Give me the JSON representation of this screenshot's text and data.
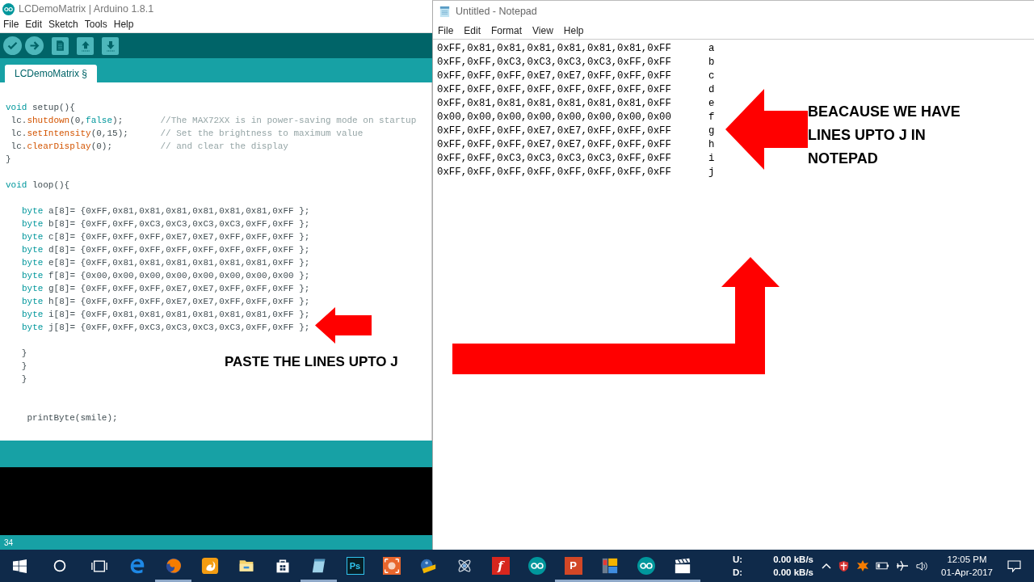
{
  "arduino": {
    "title": "LCDemoMatrix | Arduino 1.8.1",
    "menu": [
      "File",
      "Edit",
      "Sketch",
      "Tools",
      "Help"
    ],
    "toolbar": [
      {
        "kind": "verify"
      },
      {
        "kind": "upload"
      },
      {
        "kind": "new"
      },
      {
        "kind": "open"
      },
      {
        "kind": "save"
      }
    ],
    "tab": {
      "label": "LCDemoMatrix §",
      "selected": true
    },
    "code_blocks": [
      [
        [
          {
            "kind": "keyword",
            "text": "void"
          },
          {
            "kind": "plain",
            "text": " setup(){"
          }
        ],
        [
          {
            "kind": "plain",
            "text": " lc."
          },
          {
            "kind": "function",
            "text": "shutdown"
          },
          {
            "kind": "plain",
            "text": "(0,"
          },
          {
            "kind": "keyword",
            "text": "false"
          },
          {
            "kind": "plain",
            "text": ");       "
          },
          {
            "kind": "comment",
            "text": "//The MAX72XX is in power-saving mode on startup"
          }
        ],
        [
          {
            "kind": "plain",
            "text": " lc."
          },
          {
            "kind": "function",
            "text": "setIntensity"
          },
          {
            "kind": "plain",
            "text": "(0,15);      "
          },
          {
            "kind": "comment",
            "text": "// Set the brightness to maximum value"
          }
        ],
        [
          {
            "kind": "plain",
            "text": " lc."
          },
          {
            "kind": "function",
            "text": "clearDisplay"
          },
          {
            "kind": "plain",
            "text": "(0);         "
          },
          {
            "kind": "comment",
            "text": "// and clear the display"
          }
        ],
        [
          {
            "kind": "plain",
            "text": "}"
          }
        ]
      ],
      [
        [
          {
            "kind": "keyword",
            "text": "void"
          },
          {
            "kind": "plain",
            "text": " loop(){"
          }
        ]
      ],
      [
        [
          {
            "kind": "keyword",
            "text": "byte"
          },
          {
            "kind": "plain",
            "text": " a[8]= {0xFF,0x81,0x81,0x81,0x81,0x81,0x81,0xFF };"
          }
        ],
        [
          {
            "kind": "keyword",
            "text": "byte"
          },
          {
            "kind": "plain",
            "text": " b[8]= {0xFF,0xFF,0xC3,0xC3,0xC3,0xC3,0xFF,0xFF };"
          }
        ],
        [
          {
            "kind": "keyword",
            "text": "byte"
          },
          {
            "kind": "plain",
            "text": " c[8]= {0xFF,0xFF,0xFF,0xE7,0xE7,0xFF,0xFF,0xFF };"
          }
        ],
        [
          {
            "kind": "keyword",
            "text": "byte"
          },
          {
            "kind": "plain",
            "text": " d[8]= {0xFF,0xFF,0xFF,0xFF,0xFF,0xFF,0xFF,0xFF };"
          }
        ],
        [
          {
            "kind": "keyword",
            "text": "byte"
          },
          {
            "kind": "plain",
            "text": " e[8]= {0xFF,0x81,0x81,0x81,0x81,0x81,0x81,0xFF };"
          }
        ],
        [
          {
            "kind": "keyword",
            "text": "byte"
          },
          {
            "kind": "plain",
            "text": " f[8]= {0x00,0x00,0x00,0x00,0x00,0x00,0x00,0x00 };"
          }
        ],
        [
          {
            "kind": "keyword",
            "text": "byte"
          },
          {
            "kind": "plain",
            "text": " g[8]= {0xFF,0xFF,0xFF,0xE7,0xE7,0xFF,0xFF,0xFF };"
          }
        ],
        [
          {
            "kind": "keyword",
            "text": "byte"
          },
          {
            "kind": "plain",
            "text": " h[8]= {0xFF,0xFF,0xFF,0xE7,0xE7,0xFF,0xFF,0xFF };"
          }
        ],
        [
          {
            "kind": "keyword",
            "text": "byte"
          },
          {
            "kind": "plain",
            "text": " i[8]= {0xFF,0x81,0x81,0x81,0x81,0x81,0x81,0xFF };"
          }
        ],
        [
          {
            "kind": "keyword",
            "text": "byte"
          },
          {
            "kind": "plain",
            "text": " j[8]= {0xFF,0xFF,0xC3,0xC3,0xC3,0xC3,0xFF,0xFF };"
          }
        ]
      ],
      [
        [
          {
            "kind": "plain",
            "text": "   }"
          }
        ],
        [
          {
            "kind": "plain",
            "text": "   }"
          }
        ],
        [
          {
            "kind": "plain",
            "text": "   }"
          }
        ]
      ],
      [
        [
          {
            "kind": "plain",
            "text": "    printByte(smile);"
          }
        ]
      ]
    ],
    "status_line": "34"
  },
  "notepad": {
    "title": "Untitled - Notepad",
    "menu": [
      "File",
      "Edit",
      "Format",
      "View",
      "Help"
    ],
    "rows": [
      {
        "values": "0xFF,0x81,0x81,0x81,0x81,0x81,0x81,0xFF",
        "letter": "a"
      },
      {
        "values": "0xFF,0xFF,0xC3,0xC3,0xC3,0xC3,0xFF,0xFF",
        "letter": "b"
      },
      {
        "values": "0xFF,0xFF,0xFF,0xE7,0xE7,0xFF,0xFF,0xFF",
        "letter": "c"
      },
      {
        "values": "0xFF,0xFF,0xFF,0xFF,0xFF,0xFF,0xFF,0xFF",
        "letter": "d"
      },
      {
        "values": "0xFF,0x81,0x81,0x81,0x81,0x81,0x81,0xFF",
        "letter": "e"
      },
      {
        "values": "0x00,0x00,0x00,0x00,0x00,0x00,0x00,0x00",
        "letter": "f"
      },
      {
        "values": "0xFF,0xFF,0xFF,0xE7,0xE7,0xFF,0xFF,0xFF",
        "letter": "g"
      },
      {
        "values": "0xFF,0xFF,0xFF,0xE7,0xE7,0xFF,0xFF,0xFF",
        "letter": "h"
      },
      {
        "values": "0xFF,0xFF,0xC3,0xC3,0xC3,0xC3,0xFF,0xFF",
        "letter": "i"
      },
      {
        "values": "0xFF,0xFF,0xFF,0xFF,0xFF,0xFF,0xFF,0xFF",
        "letter": "j"
      }
    ]
  },
  "annotations": {
    "paste_note": "PASTE THE LINES UPTO J",
    "notepad_note": [
      "BEACAUSE WE HAVE",
      "LINES UPTO J IN",
      "NOTEPAD"
    ]
  },
  "taskbar": {
    "apps": [
      {
        "kind": "start",
        "running": false
      },
      {
        "kind": "cortana",
        "running": false
      },
      {
        "kind": "taskview",
        "running": false
      },
      {
        "kind": "edge",
        "running": false
      },
      {
        "kind": "firefox",
        "running": true
      },
      {
        "kind": "uc",
        "running": false
      },
      {
        "kind": "explorer",
        "running": false
      },
      {
        "kind": "store",
        "running": false
      },
      {
        "kind": "notepad",
        "running": true
      },
      {
        "kind": "ps",
        "label": "Ps",
        "running": false
      },
      {
        "kind": "record",
        "running": false
      },
      {
        "kind": "movie",
        "running": false
      },
      {
        "kind": "atom",
        "running": false
      },
      {
        "kind": "flash",
        "label": "f",
        "running": false
      },
      {
        "kind": "arduino",
        "running": false
      },
      {
        "kind": "ppt",
        "label": "P",
        "running": true
      },
      {
        "kind": "tiles",
        "running": true
      },
      {
        "kind": "arduino",
        "running": true
      },
      {
        "kind": "clapper",
        "running": true
      }
    ],
    "net": [
      {
        "label": "U:",
        "speed": "0.00 kB/s"
      },
      {
        "label": "D:",
        "speed": "0.00 kB/s"
      }
    ],
    "time": "12:05 PM",
    "date": "01-Apr-2017"
  }
}
